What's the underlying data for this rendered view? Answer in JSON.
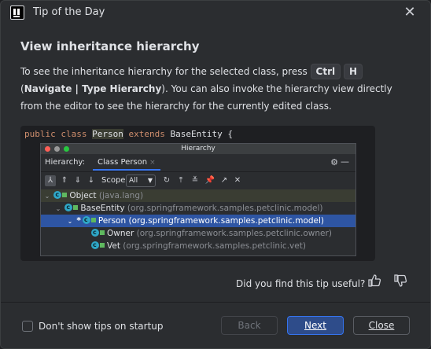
{
  "dialog": {
    "title": "Tip of the Day",
    "close_glyph": "✕"
  },
  "tip": {
    "heading": "View inheritance hierarchy",
    "body_1": "To see the inheritance hierarchy for the selected class, press ",
    "key_1": "Ctrl",
    "key_2": "H",
    "body_2": " (",
    "menu_path": "Navigate | Type Hierarchy",
    "body_3": "). You can also invoke the hierarchy view directly from the editor to see the hierarchy for the currently edited class."
  },
  "demo": {
    "code": {
      "kw_public": "public",
      "kw_class": "class",
      "class_name": "Person",
      "kw_extends": "extends",
      "parent": "BaseEntity {"
    },
    "hierarchy_window": {
      "caption": "Hierarchy",
      "label": "Hierarchy:",
      "tab": "Class Person",
      "tab_close": "×",
      "scope_label": "Scope:",
      "scope_value": "All",
      "tree": [
        {
          "name": "Object",
          "pkg": "(java.lang)",
          "chevron": "⌄"
        },
        {
          "name": "BaseEntity",
          "pkg": "(org.springframework.samples.petclinic.model)",
          "chevron": "⌄"
        },
        {
          "star": "*",
          "name": "Person",
          "pkg": "(org.springframework.samples.petclinic.model)",
          "chevron": "⌄"
        },
        {
          "name": "Owner",
          "pkg": "(org.springframework.samples.petclinic.owner)"
        },
        {
          "name": "Vet",
          "pkg": "(org.springframework.samples.petclinic.vet)"
        }
      ]
    }
  },
  "feedback": {
    "question": "Did you find this tip useful?",
    "thumbs_up": "👍",
    "thumbs_down": "👎"
  },
  "footer": {
    "checkbox_label": "Don't show tips on startup",
    "checkbox_checked": false,
    "back_label": "Back",
    "next_label": "Next",
    "close_label": "Close"
  },
  "colors": {
    "accent": "#3574f0",
    "selection": "#2e55a3",
    "background": "#2b2d30"
  }
}
